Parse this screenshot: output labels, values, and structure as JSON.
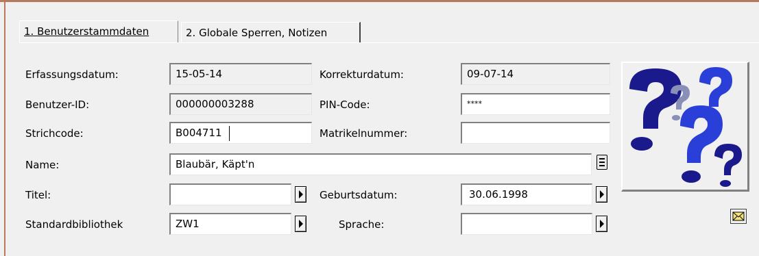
{
  "tabs": [
    {
      "label": "1. Benutzerstammdaten"
    },
    {
      "label": "2. Globale Sperren, Notizen"
    }
  ],
  "fields": {
    "erfassungsdatum": {
      "label": "Erfassungsdatum:",
      "value": "15-05-14"
    },
    "korrekturdatum": {
      "label": "Korrekturdatum:",
      "value": "09-07-14"
    },
    "benutzer_id": {
      "label": "Benutzer-ID:",
      "value": "000000003288"
    },
    "pin_code": {
      "label": "PIN-Code:",
      "value": "****"
    },
    "strichcode": {
      "label": "Strichcode:",
      "value": "B004711"
    },
    "matrikelnummer": {
      "label": "Matrikelnummer:",
      "value": ""
    },
    "name": {
      "label": "Name:",
      "value": "Blaubär, Käpt'n"
    },
    "titel": {
      "label": "Titel:",
      "value": ""
    },
    "geburtsdatum": {
      "label": "Geburtsdatum:",
      "value": "30.06.1998"
    },
    "standardbibliothek": {
      "label": "Standardbibliothek",
      "value": "ZW1"
    },
    "sprache": {
      "label": "Sprache:",
      "value": ""
    }
  },
  "colors": {
    "frame_accent": "#b87a5e",
    "question_dark": "#1a1a8c",
    "question_light": "#2a3fd8"
  },
  "icons": {
    "photo_placeholder": "question-marks-icon",
    "mail": "envelope-icon"
  }
}
